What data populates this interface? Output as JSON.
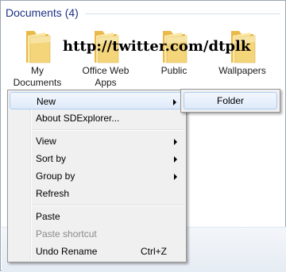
{
  "group": {
    "title": "Documents (4)"
  },
  "files": [
    {
      "label": "My Documents",
      "icon": "folder-icon"
    },
    {
      "label": "Office Web Apps",
      "icon": "folder-icon"
    },
    {
      "label": "Public",
      "icon": "folder-icon"
    },
    {
      "label": "Wallpapers",
      "icon": "folder-icon"
    }
  ],
  "watermark": "http://twitter.com/dtplk",
  "context_menu": {
    "new": "New",
    "about": "About SDExplorer...",
    "view": "View",
    "sort_by": "Sort by",
    "group_by": "Group by",
    "refresh": "Refresh",
    "paste": "Paste",
    "paste_shortcut": "Paste shortcut",
    "undo_rename": "Undo Rename",
    "undo_shortcut": "Ctrl+Z"
  },
  "submenu": {
    "folder": "Folder"
  },
  "colors": {
    "group_title": "#1e3287",
    "folder_body": "#f4d57a",
    "highlight_border": "#aeccf1"
  }
}
